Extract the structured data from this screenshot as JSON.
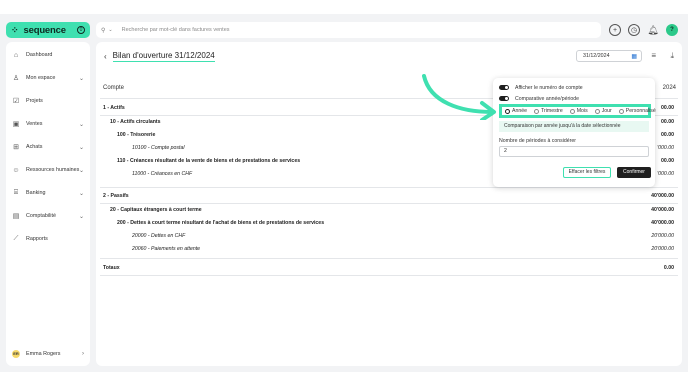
{
  "app": {
    "logo_text": "sequence",
    "logo_badge": "0"
  },
  "search": {
    "placeholder": "Recherche par mot-clé dans factures ventes"
  },
  "user_initials": "?",
  "sidebar": {
    "items": [
      {
        "label": "Dashboard",
        "icon": "home-icon"
      },
      {
        "label": "Mon espace",
        "icon": "user-icon"
      },
      {
        "label": "Projets",
        "icon": "checkbox-icon"
      },
      {
        "label": "Ventes",
        "icon": "wallet-icon"
      },
      {
        "label": "Achats",
        "icon": "cart-icon"
      },
      {
        "label": "Ressources humaines",
        "icon": "people-icon"
      },
      {
        "label": "Banking",
        "icon": "bank-icon"
      },
      {
        "label": "Comptabilité",
        "icon": "calculator-icon"
      },
      {
        "label": "Rapports",
        "icon": "chart-icon"
      }
    ],
    "user": {
      "initials": "ER",
      "name": "Emma Rogers"
    }
  },
  "header": {
    "title": "Bilan d'ouverture 31/12/2024",
    "date": "31/12/2024"
  },
  "table": {
    "col_label": "Compte",
    "col_year": "2024",
    "rows": [
      {
        "label": "1 - Actifs",
        "amount": "00.00"
      },
      {
        "label": "10 - Actifs circulants",
        "amount": "00.00"
      },
      {
        "label": "100 - Trésorerie",
        "amount": "00.00"
      },
      {
        "label": "10100 - Compte postal",
        "amount": "'000.00"
      },
      {
        "label": "110 - Créances résultant de la vente de biens et de prestations de services",
        "amount": "00.00"
      },
      {
        "label": "11000 - Créances en CHF",
        "amount": "'000.00"
      },
      {
        "label": "2 - Passifs",
        "amount": "40'000.00"
      },
      {
        "label": "20 - Capitaux étrangers à court terme",
        "amount": "40'000.00"
      },
      {
        "label": "200 - Dettes à court terme résultant de l'achat de biens et de prestations de services",
        "amount": "40'000.00"
      },
      {
        "label": "20000 - Dettes en CHF",
        "amount": "20'000.00"
      },
      {
        "label": "20060 - Paiements en attente",
        "amount": "20'000.00"
      },
      {
        "label": "Totaux",
        "amount": "0.00"
      }
    ]
  },
  "popover": {
    "toggle_1": "Afficher le numéro de compte",
    "toggle_2": "Comparative année/période",
    "periods": [
      "Année",
      "Trimestre",
      "Mois",
      "Jour",
      "Personnalisé"
    ],
    "hint": "Comparaison par année jusqu'à la date sélectionnée",
    "periods_label": "Nombre de périodes à considérer",
    "periods_value": "2",
    "clear_button": "Effacer les filtres",
    "confirm_button": "Confirmer"
  },
  "colors": {
    "accent": "#3fe0b0",
    "dark": "#1f1f1f"
  }
}
